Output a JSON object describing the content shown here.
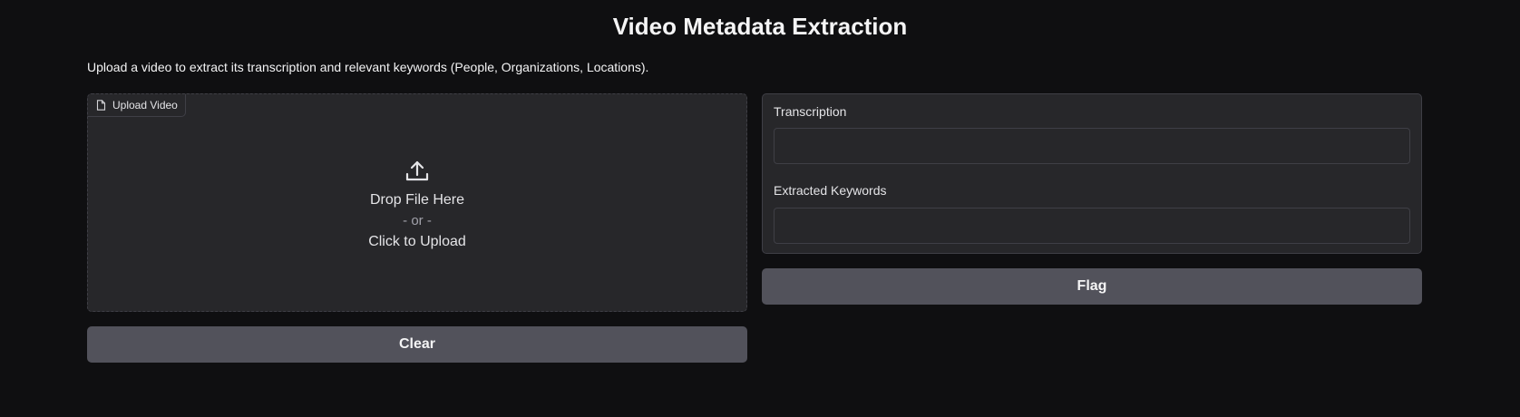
{
  "header": {
    "title": "Video Metadata Extraction",
    "description": "Upload a video to extract its transcription and relevant keywords (People, Organizations, Locations)."
  },
  "upload": {
    "label": "Upload Video",
    "label_icon": "file-icon",
    "drop_icon": "upload-icon",
    "drop_text": "Drop File Here",
    "or_text": "- or -",
    "click_text": "Click to Upload"
  },
  "outputs": {
    "transcription_label": "Transcription",
    "transcription_value": "",
    "keywords_label": "Extracted Keywords",
    "keywords_value": ""
  },
  "buttons": {
    "clear_label": "Clear",
    "flag_label": "Flag"
  },
  "colors": {
    "background": "#0f0f11",
    "panel": "#27272a",
    "border": "#3f3f46",
    "button": "#52525b",
    "text": "#f4f4f5"
  }
}
